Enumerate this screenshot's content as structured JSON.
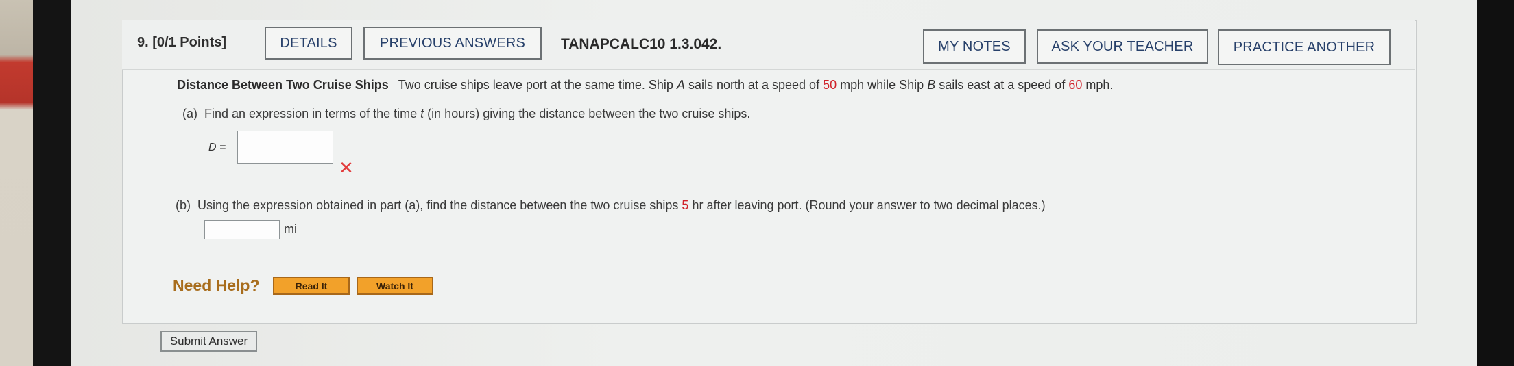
{
  "question": {
    "number_label": "9.  [0/1 Points]",
    "code": "TANAPCALC10 1.3.042."
  },
  "toolbar": {
    "details_label": "DETAILS",
    "previous_answers_label": "PREVIOUS ANSWERS",
    "my_notes_label": "MY NOTES",
    "ask_teacher_label": "ASK YOUR TEACHER",
    "practice_another_label": "PRACTICE ANOTHER"
  },
  "problem": {
    "title": "Distance Between Two Cruise Ships",
    "text_1": "Two cruise ships leave port at the same time. Ship ",
    "ship_a": "A",
    "text_2": " sails north at a speed of ",
    "speed_a": "50",
    "text_3": " mph while Ship ",
    "ship_b": "B",
    "text_4": " sails east at a speed of ",
    "speed_b": "60",
    "text_5": " mph."
  },
  "part_a": {
    "prefix": "(a)",
    "text_1": "Find an expression in terms of the time ",
    "var": "t",
    "text_2": " (in hours) giving the distance between the two cruise ships.",
    "input_label": "D =",
    "input_value": "",
    "status_mark": "✕"
  },
  "part_b": {
    "prefix": "(b)",
    "text_1": "Using the expression obtained in part (a), find the distance between the two cruise ships ",
    "hours": "5",
    "text_2": " hr after leaving port. (Round your answer to two decimal places.)",
    "input_value": "",
    "unit": "mi"
  },
  "help": {
    "label": "Need Help?",
    "read_it": "Read It",
    "watch_it": "Watch It"
  },
  "submit_label": "Submit Answer"
}
